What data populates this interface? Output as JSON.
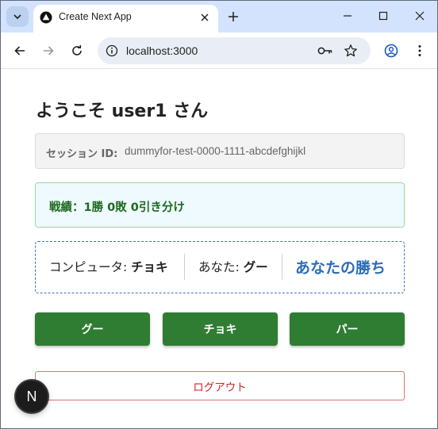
{
  "browser": {
    "tab": {
      "title": "Create Next App"
    },
    "url": "localhost:3000",
    "icons": {
      "tab_search": "chevron-down-icon",
      "favicon": "nextjs-triangle-icon",
      "tab_close": "close-icon",
      "new_tab": "plus-icon",
      "minimize": "minimize-icon",
      "maximize": "maximize-icon",
      "close_window": "close-icon",
      "back": "back-arrow-icon",
      "forward": "forward-arrow-icon",
      "reload": "reload-icon",
      "site_info": "info-icon",
      "password": "key-icon",
      "bookmark": "star-icon",
      "profile": "profile-icon",
      "menu": "kebab-menu-icon"
    }
  },
  "page": {
    "heading": "ようこそ user1 さん",
    "session": {
      "label": "セッション ID:",
      "value": "dummyfor-test-0000-1111-abcdefghijkl"
    },
    "score": "戦績：1勝 0敗 0引き分け",
    "result": {
      "computer_label": "コンピュータ:",
      "computer_hand": "チョキ",
      "you_label": "あなた:",
      "you_hand": "グー",
      "outcome": "あなたの勝ち"
    },
    "buttons": {
      "rock": "グー",
      "scissors": "チョキ",
      "paper": "パー",
      "logout": "ログアウト"
    },
    "next_badge": "N"
  },
  "colors": {
    "tabstrip": "#d3e3fd",
    "hand_button": "#2e7d32",
    "score_text": "#1e6a1e",
    "outcome_text": "#2a6cb8",
    "logout_text": "#c62828"
  }
}
